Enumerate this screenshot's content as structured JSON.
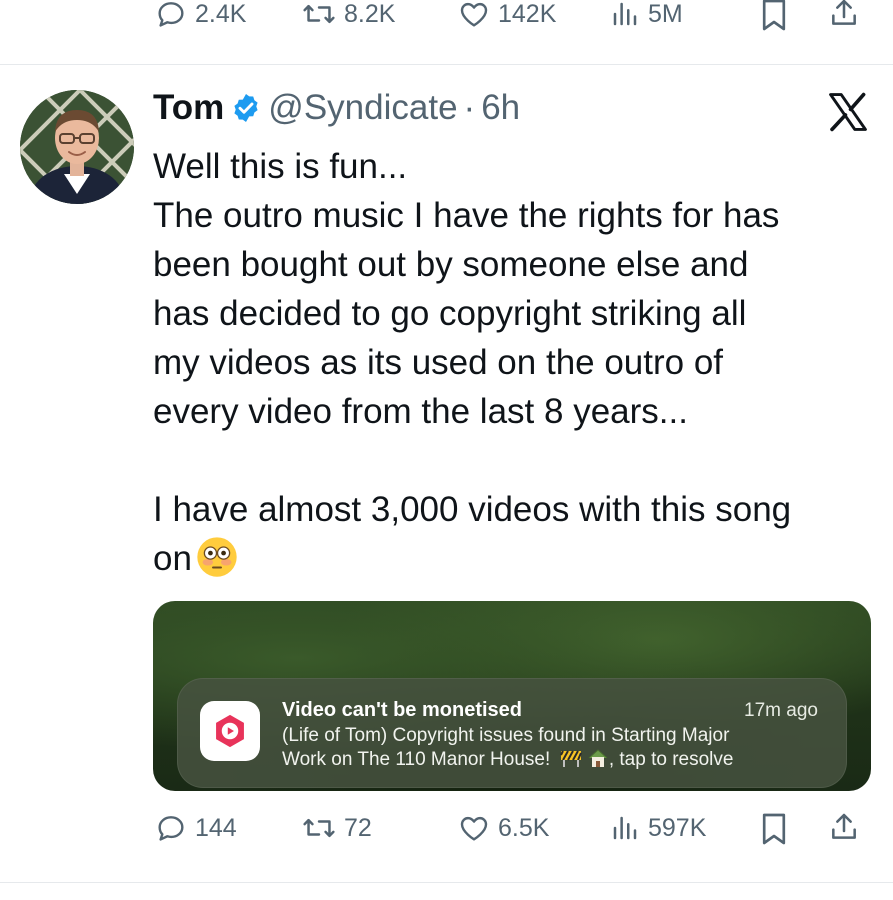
{
  "top_actions": {
    "replies": "2.4K",
    "reposts": "8.2K",
    "likes": "142K",
    "views": "5M"
  },
  "tweet": {
    "author_name": "Tom",
    "handle": "@Syndicate",
    "separator": "·",
    "time": "6h",
    "body_lines": [
      "Well this is fun...",
      "The outro music I have the rights for has",
      "been bought out by someone else and",
      "has decided to go copyright striking all",
      "my videos as its used on the outro of",
      "every video from the last 8 years..."
    ],
    "body_second": "I have almost 3,000 videos with this song",
    "body_third": "on",
    "media": {
      "notification_title": "Video can't be monetised",
      "notification_time": "17m ago",
      "notification_line1": "(Life of Tom) Copyright issues found in Starting Major",
      "notification_line2_prefix": "Work on The 110 Manor House!",
      "notification_line2_suffix": ", tap to resolve"
    },
    "actions": {
      "replies": "144",
      "reposts": "72",
      "likes": "6.5K",
      "views": "597K"
    }
  },
  "colors": {
    "text": "#0f1419",
    "secondary": "#536471",
    "verified": "#1d9bf0",
    "youtube_studio": "#e8335a"
  },
  "icons": [
    "reply-icon",
    "repost-icon",
    "like-icon",
    "views-icon",
    "bookmark-icon",
    "share-icon",
    "verified-badge-icon",
    "x-logo-icon",
    "flushed-emoji-icon",
    "youtube-studio-icon",
    "construction-icon",
    "house-icon"
  ]
}
